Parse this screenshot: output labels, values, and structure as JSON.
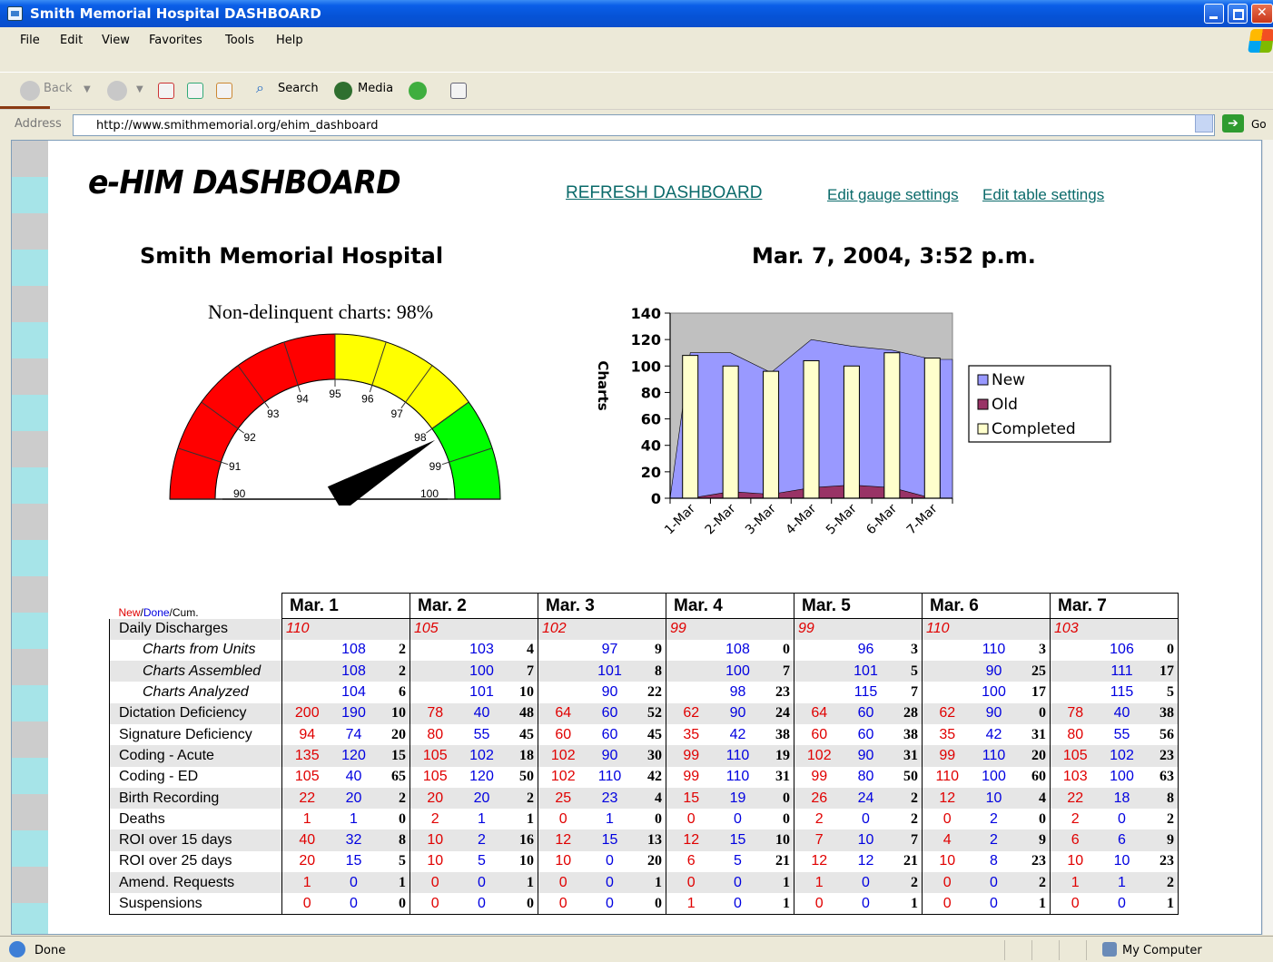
{
  "window": {
    "title": "Smith Memorial Hospital DASHBOARD"
  },
  "menu": [
    "File",
    "Edit",
    "View",
    "Favorites",
    "Tools",
    "Help"
  ],
  "toolbar": {
    "back": "Back",
    "search": "Search",
    "media": "Media"
  },
  "address": {
    "label": "Address",
    "url": "http://www.smithmemorial.org/ehim_dashboard",
    "go": "Go"
  },
  "header": {
    "logo": "e-HIM DASHBOARD",
    "refresh": "REFRESH DASHBOARD",
    "edit_gauge": "Edit gauge settings",
    "edit_table": "Edit table settings",
    "hospital": "Smith Memorial Hospital",
    "datetime": "Mar. 7, 2004, 3:52 p.m."
  },
  "gauge": {
    "title": "Non-delinquent charts: 98%",
    "min": 90,
    "max": 100,
    "value": 98.3,
    "ticks": [
      "90",
      "91",
      "92",
      "93",
      "94",
      "95",
      "96",
      "97",
      "98",
      "99",
      "100"
    ],
    "colors": {
      "red": "#ff0000",
      "yellow": "#ffff00",
      "green": "#00ff00"
    }
  },
  "chart_data": {
    "type": "area",
    "categories": [
      "1-Mar",
      "2-Mar",
      "3-Mar",
      "4-Mar",
      "5-Mar",
      "6-Mar",
      "7-Mar"
    ],
    "ylabel": "Charts",
    "ylim": [
      0,
      140
    ],
    "yticks": [
      "0",
      "20",
      "40",
      "60",
      "80",
      "100",
      "120",
      "140"
    ],
    "legend_position": "right",
    "series": [
      {
        "name": "New",
        "color": "#9999ff",
        "values": [
          110,
          110,
          95,
          120,
          115,
          112,
          105
        ]
      },
      {
        "name": "Old",
        "color": "#993366",
        "values": [
          0,
          5,
          3,
          8,
          10,
          8,
          0
        ]
      },
      {
        "name": "Completed",
        "color": "#ffffcc",
        "values": [
          108,
          100,
          96,
          104,
          100,
          110,
          106
        ]
      }
    ]
  },
  "table": {
    "legend": {
      "new": "New",
      "done": "Done",
      "cum": "Cum."
    },
    "dates": [
      "Mar. 1",
      "Mar. 2",
      "Mar. 3",
      "Mar. 4",
      "Mar. 5",
      "Mar. 6",
      "Mar. 7"
    ],
    "discharges": {
      "label": "Daily Discharges",
      "values": [
        "110",
        "105",
        "102",
        "99",
        "99",
        "110",
        "103"
      ]
    },
    "rows": [
      {
        "label": "Charts from Units",
        "indent": true,
        "shade": false,
        "cells": [
          [
            "",
            "108",
            "2"
          ],
          [
            "",
            "103",
            "4"
          ],
          [
            "",
            "97",
            "9"
          ],
          [
            "",
            "108",
            "0"
          ],
          [
            "",
            "96",
            "3"
          ],
          [
            "",
            "110",
            "3"
          ],
          [
            "",
            "106",
            "0"
          ]
        ]
      },
      {
        "label": "Charts Assembled",
        "indent": true,
        "shade": true,
        "cells": [
          [
            "",
            "108",
            "2"
          ],
          [
            "",
            "100",
            "7"
          ],
          [
            "",
            "101",
            "8"
          ],
          [
            "",
            "100",
            "7"
          ],
          [
            "",
            "101",
            "5"
          ],
          [
            "",
            "90",
            "25"
          ],
          [
            "",
            "111",
            "17"
          ]
        ]
      },
      {
        "label": "Charts Analyzed",
        "indent": true,
        "shade": false,
        "cells": [
          [
            "",
            "104",
            "6"
          ],
          [
            "",
            "101",
            "10"
          ],
          [
            "",
            "90",
            "22"
          ],
          [
            "",
            "98",
            "23"
          ],
          [
            "",
            "115",
            "7"
          ],
          [
            "",
            "100",
            "17"
          ],
          [
            "",
            "115",
            "5"
          ]
        ]
      },
      {
        "label": "Dictation Deficiency",
        "indent": false,
        "shade": true,
        "cells": [
          [
            "200",
            "190",
            "10"
          ],
          [
            "78",
            "40",
            "48"
          ],
          [
            "64",
            "60",
            "52"
          ],
          [
            "62",
            "90",
            "24"
          ],
          [
            "64",
            "60",
            "28"
          ],
          [
            "62",
            "90",
            "0"
          ],
          [
            "78",
            "40",
            "38"
          ]
        ]
      },
      {
        "label": "Signature Deficiency",
        "indent": false,
        "shade": false,
        "cells": [
          [
            "94",
            "74",
            "20"
          ],
          [
            "80",
            "55",
            "45"
          ],
          [
            "60",
            "60",
            "45"
          ],
          [
            "35",
            "42",
            "38"
          ],
          [
            "60",
            "60",
            "38"
          ],
          [
            "35",
            "42",
            "31"
          ],
          [
            "80",
            "55",
            "56"
          ]
        ]
      },
      {
        "label": "Coding - Acute",
        "indent": false,
        "shade": true,
        "cells": [
          [
            "135",
            "120",
            "15"
          ],
          [
            "105",
            "102",
            "18"
          ],
          [
            "102",
            "90",
            "30"
          ],
          [
            "99",
            "110",
            "19"
          ],
          [
            "102",
            "90",
            "31"
          ],
          [
            "99",
            "110",
            "20"
          ],
          [
            "105",
            "102",
            "23"
          ]
        ]
      },
      {
        "label": "Coding - ED",
        "indent": false,
        "shade": false,
        "cells": [
          [
            "105",
            "40",
            "65"
          ],
          [
            "105",
            "120",
            "50"
          ],
          [
            "102",
            "110",
            "42"
          ],
          [
            "99",
            "110",
            "31"
          ],
          [
            "99",
            "80",
            "50"
          ],
          [
            "110",
            "100",
            "60"
          ],
          [
            "103",
            "100",
            "63"
          ]
        ]
      },
      {
        "label": "Birth Recording",
        "indent": false,
        "shade": true,
        "cells": [
          [
            "22",
            "20",
            "2"
          ],
          [
            "20",
            "20",
            "2"
          ],
          [
            "25",
            "23",
            "4"
          ],
          [
            "15",
            "19",
            "0"
          ],
          [
            "26",
            "24",
            "2"
          ],
          [
            "12",
            "10",
            "4"
          ],
          [
            "22",
            "18",
            "8"
          ]
        ]
      },
      {
        "label": "Deaths",
        "indent": false,
        "shade": false,
        "cells": [
          [
            "1",
            "1",
            "0"
          ],
          [
            "2",
            "1",
            "1"
          ],
          [
            "0",
            "1",
            "0"
          ],
          [
            "0",
            "0",
            "0"
          ],
          [
            "2",
            "0",
            "2"
          ],
          [
            "0",
            "2",
            "0"
          ],
          [
            "2",
            "0",
            "2"
          ]
        ]
      },
      {
        "label": "ROI over 15 days",
        "indent": false,
        "shade": true,
        "cells": [
          [
            "40",
            "32",
            "8"
          ],
          [
            "10",
            "2",
            "16"
          ],
          [
            "12",
            "15",
            "13"
          ],
          [
            "12",
            "15",
            "10"
          ],
          [
            "7",
            "10",
            "7"
          ],
          [
            "4",
            "2",
            "9"
          ],
          [
            "6",
            "6",
            "9"
          ]
        ]
      },
      {
        "label": "ROI over 25 days",
        "indent": false,
        "shade": false,
        "cells": [
          [
            "20",
            "15",
            "5"
          ],
          [
            "10",
            "5",
            "10"
          ],
          [
            "10",
            "0",
            "20"
          ],
          [
            "6",
            "5",
            "21"
          ],
          [
            "12",
            "12",
            "21"
          ],
          [
            "10",
            "8",
            "23"
          ],
          [
            "10",
            "10",
            "23"
          ]
        ]
      },
      {
        "label": "Amend. Requests",
        "indent": false,
        "shade": true,
        "cells": [
          [
            "1",
            "0",
            "1"
          ],
          [
            "0",
            "0",
            "1"
          ],
          [
            "0",
            "0",
            "1"
          ],
          [
            "0",
            "0",
            "1"
          ],
          [
            "1",
            "0",
            "2"
          ],
          [
            "0",
            "0",
            "2"
          ],
          [
            "1",
            "1",
            "2"
          ]
        ]
      },
      {
        "label": "Suspensions",
        "indent": false,
        "shade": false,
        "cells": [
          [
            "0",
            "0",
            "0"
          ],
          [
            "0",
            "0",
            "0"
          ],
          [
            "0",
            "0",
            "0"
          ],
          [
            "1",
            "0",
            "1"
          ],
          [
            "0",
            "0",
            "1"
          ],
          [
            "0",
            "0",
            "1"
          ],
          [
            "0",
            "0",
            "1"
          ]
        ]
      }
    ]
  },
  "status": {
    "left": "Done",
    "right": "My Computer"
  }
}
